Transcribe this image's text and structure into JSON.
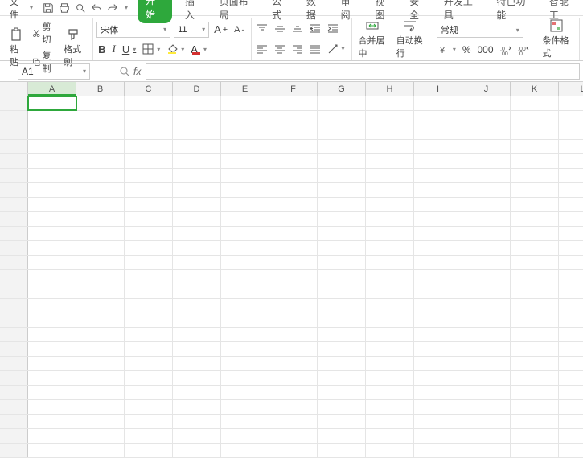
{
  "menu": {
    "file": "文件",
    "tabs": [
      "开始",
      "插入",
      "页面布局",
      "公式",
      "数据",
      "审阅",
      "视图",
      "安全",
      "开发工具",
      "特色功能",
      "智能工"
    ]
  },
  "clipboard": {
    "paste": "粘贴",
    "cut": "剪切",
    "copy": "复制",
    "formatpainter": "格式刷"
  },
  "font": {
    "name": "宋体",
    "size": "11"
  },
  "merge": {
    "label": "合并居中"
  },
  "wrap": {
    "label": "自动换行"
  },
  "numfmt": {
    "label": "常规"
  },
  "condfmt": {
    "label": "条件格式"
  },
  "namebox": {
    "value": "A1"
  },
  "columns": [
    "A",
    "B",
    "C",
    "D",
    "E",
    "F",
    "G",
    "H",
    "I",
    "J",
    "K",
    "L"
  ],
  "rows_count": 25,
  "selected": {
    "col": "A",
    "row": 1
  }
}
